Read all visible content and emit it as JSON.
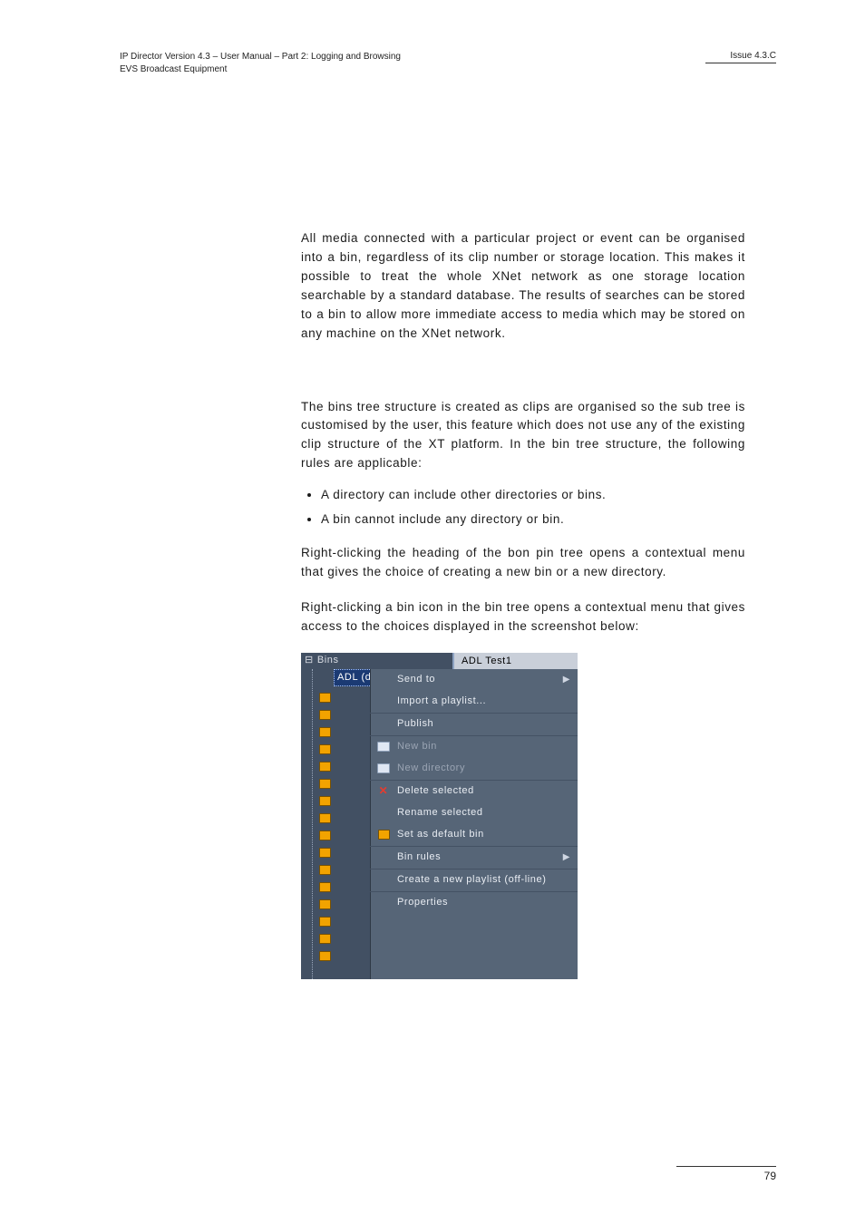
{
  "header": {
    "left_line1": "IP Director Version 4.3 – User Manual – Part 2: Logging and Browsing",
    "left_line2": "EVS Broadcast Equipment",
    "right": "Issue 4.3.C"
  },
  "body": {
    "para1": "All media connected with a particular project or event can be organised into a bin, regardless of its clip number or storage location. This makes it possible to treat the whole XNet network as one storage location searchable by a standard database. The results of searches can be stored to a bin to allow more immediate access to media which may be stored on any machine on the XNet network.",
    "para2": "The bins tree structure is created as clips are organised so the sub tree is customised by the user, this feature which does not use any of the existing clip structure of the XT platform. In the bin tree structure, the following rules are applicable:",
    "rules": [
      "A directory can include other directories or bins.",
      "A bin cannot include any directory or bin."
    ],
    "para3": "Right-clicking the heading of the bon pin tree opens a contextual menu that gives the choice of creating a new bin or a new directory.",
    "para4": "Right-clicking a bin icon in the bin tree opens a contextual menu that gives access to the choices displayed in the screenshot below:"
  },
  "figure": {
    "root": "Bins",
    "selected": "ADL (default)",
    "panel_title": "ADL Test1",
    "menu": {
      "send_to": "Send to",
      "import": "Import a playlist...",
      "publish": "Publish",
      "new_bin": "New bin",
      "new_dir": "New directory",
      "delete": "Delete selected",
      "rename": "Rename selected",
      "set_default": "Set as default bin",
      "bin_rules": "Bin rules",
      "create_pl": "Create a new playlist (off-line)",
      "properties": "Properties"
    }
  },
  "footer": {
    "page": "79"
  }
}
